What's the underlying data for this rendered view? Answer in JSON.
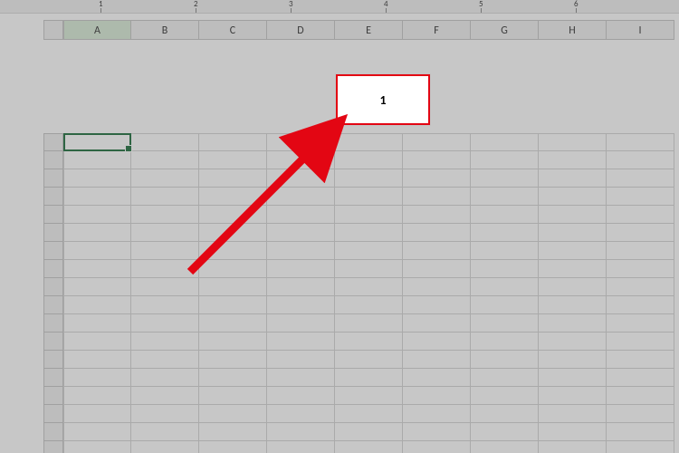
{
  "ruler": {
    "marks": [
      "1",
      "2",
      "3",
      "4",
      "5",
      "6"
    ]
  },
  "columns": [
    "A",
    "B",
    "C",
    "D",
    "E",
    "F",
    "G",
    "H",
    "I"
  ],
  "selected_column": "A",
  "active_cell": "A1",
  "grid": {
    "visible_rows": 18
  },
  "callout": {
    "text": "1"
  }
}
